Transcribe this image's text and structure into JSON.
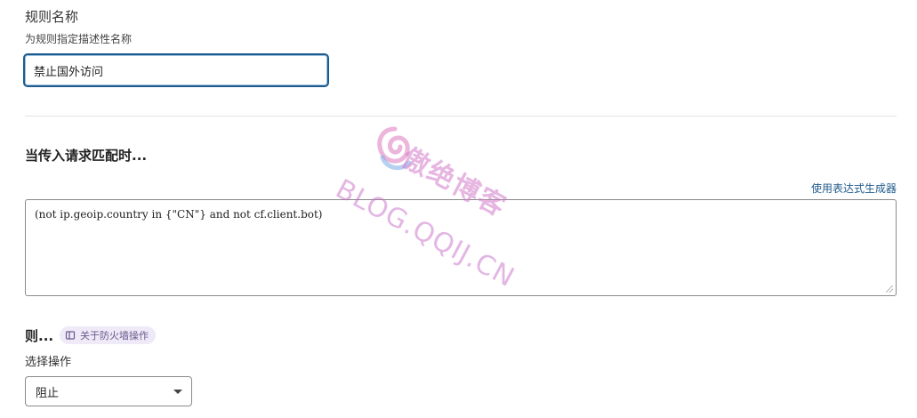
{
  "rule_name": {
    "label": "规则名称",
    "help": "为规则指定描述性名称",
    "value": "禁止国外访问"
  },
  "when": {
    "heading": "当传入请求匹配时...",
    "builder_link": "使用表达式生成器",
    "expression": "(not ip.geoip.country in {\"CN\"} and not cf.client.bot)"
  },
  "then": {
    "heading": "则...",
    "firewall_pill": "关于防火墙操作",
    "choose_label": "选择操作",
    "selected_action": "阻止"
  },
  "watermark": {
    "brand": "傲绝博客",
    "url": "BLOG.QQIJ.CN"
  },
  "colors": {
    "accent": "#1f5a8c",
    "pill_bg": "#eeeaf7",
    "pill_text": "#6a5a8e",
    "watermark": "#d278c8"
  },
  "icons": {
    "pill_icon": "book-icon",
    "select_icon": "chevron-down-icon"
  }
}
